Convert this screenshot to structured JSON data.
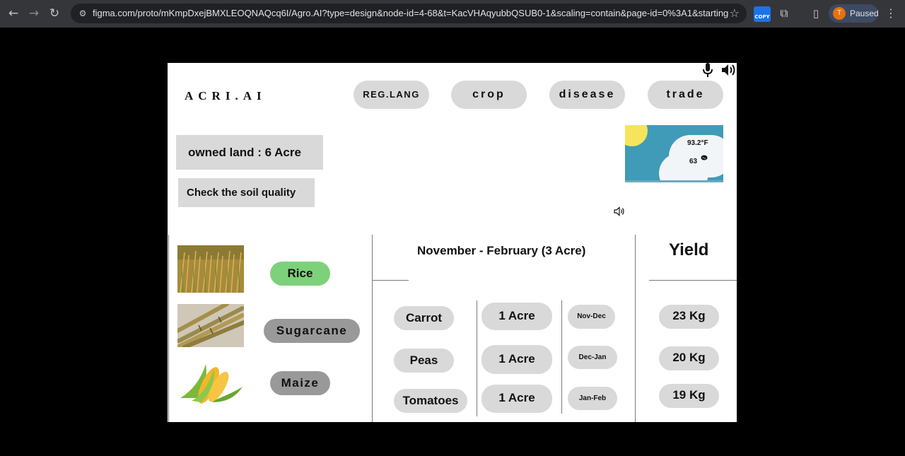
{
  "browser": {
    "url": "figma.com/proto/mKmpDxejBMXLEOQNAQcq6I/Agro.AI?type=design&node-id=4-68&t=KacVHAqyubbQSUB0-1&scaling=contain&page-id=0%3A1&starting-point-node-...",
    "ext_copy_label": "COPY",
    "profile_initial": "T",
    "profile_status": "Paused"
  },
  "app": {
    "logo": "ACRI.AI",
    "nav": [
      {
        "label": "REG.LANG"
      },
      {
        "label": "crop"
      },
      {
        "label": "disease"
      },
      {
        "label": "trade"
      }
    ]
  },
  "land": {
    "owned_label": "owned land  :  6 Acre",
    "soil_button": "Check the soil quality"
  },
  "weather": {
    "high": "93.2°F",
    "low": "63"
  },
  "crops": [
    {
      "name": "Rice",
      "color": "#7dd17a"
    },
    {
      "name": "Sugarcane",
      "color": "#999999"
    },
    {
      "name": "Maize",
      "color": "#999999"
    }
  ],
  "season": {
    "title": "November - February (3 Acre)",
    "rows": [
      {
        "crop": "Carrot",
        "area": "1 Acre",
        "months": "Nov-Dec"
      },
      {
        "crop": "Peas",
        "area": "1 Acre",
        "months": "Dec-Jan"
      },
      {
        "crop": "Tomatoes",
        "area": "1 Acre",
        "months": "Jan-Feb"
      }
    ]
  },
  "yield": {
    "title": "Yield",
    "values": [
      "23 Kg",
      "20 Kg",
      "19 Kg"
    ]
  }
}
